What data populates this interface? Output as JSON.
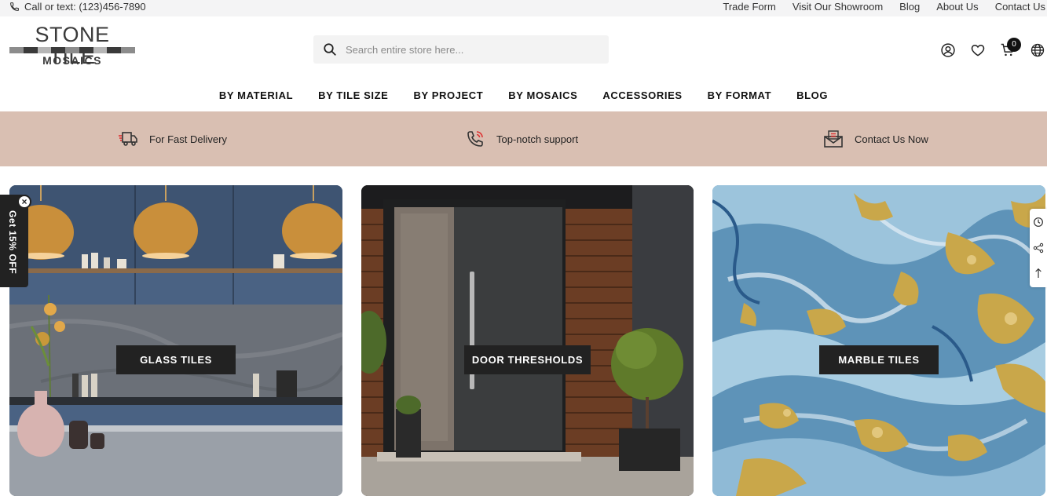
{
  "topbar": {
    "phone_text": "Call or text: (123)456-7890",
    "links": [
      "Trade Form",
      "Visit Our Showroom",
      "Blog",
      "About Us",
      "Contact Us"
    ]
  },
  "logo": {
    "line1": "STONE TILE",
    "line2": "MOSAICS"
  },
  "search": {
    "placeholder": "Search entire store here..."
  },
  "header_icons": [
    "account-icon",
    "wishlist-heart-icon",
    "cart-icon",
    "language-globe-icon"
  ],
  "cart": {
    "count": "0"
  },
  "nav": {
    "items": [
      "BY MATERIAL",
      "BY TILE SIZE",
      "BY PROJECT",
      "BY MOSAICS",
      "ACCESSORIES",
      "BY FORMAT",
      "BLOG"
    ]
  },
  "features": [
    {
      "icon": "delivery-truck-icon",
      "label": "For Fast Delivery"
    },
    {
      "icon": "support-phone-icon",
      "label": "Top-notch support"
    },
    {
      "icon": "contact-mail-icon",
      "label": "Contact Us Now"
    }
  ],
  "cards": [
    {
      "label": "GLASS TILES"
    },
    {
      "label": "DOOR THRESHOLDS"
    },
    {
      "label": "MARBLE TILES"
    }
  ],
  "promo": {
    "text": "Get 15% OFF",
    "close": "×"
  },
  "colors": {
    "features_band": "#d9bfb2",
    "label_bg": "#222222",
    "topbar_bg": "#f4f4f5"
  }
}
